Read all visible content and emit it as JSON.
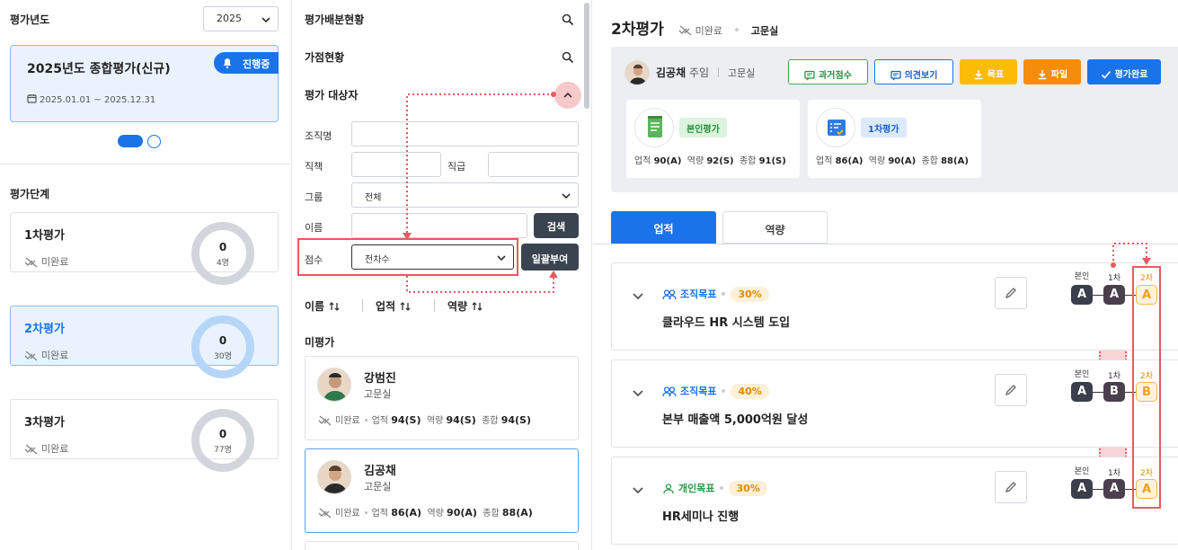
{
  "left": {
    "year_label": "평가년도",
    "year_value": "2025",
    "eval": {
      "title": "2025년도 종합평가(신규)",
      "badge": "진행중",
      "date_range": "2025.01.01 ~ 2025.12.31"
    },
    "stage_label": "평가단계",
    "stages": [
      {
        "name": "1차평가",
        "status": "미완료",
        "value": "0",
        "count": "4명"
      },
      {
        "name": "2차평가",
        "status": "미완료",
        "value": "0",
        "count": "30명"
      },
      {
        "name": "3차평가",
        "status": "미완료",
        "value": "0",
        "count": "77명"
      }
    ]
  },
  "middle": {
    "dist_title": "평가배분현황",
    "bonus_title": "가점현황",
    "target_title": "평가 대상자",
    "filters": {
      "org_label": "조직명",
      "duty_label": "직책",
      "grade_label": "직급",
      "group_label": "그룹",
      "group_value": "전체",
      "name_label": "이름",
      "search_btn": "검색",
      "score_label": "점수",
      "score_value": "전차수",
      "bulk_btn": "일괄부여"
    },
    "sort": {
      "name": "이름",
      "perf": "업적",
      "comp": "역량"
    },
    "list_title": "미평가",
    "people": [
      {
        "name": "강범진",
        "dept": "고문실",
        "status": "미완료",
        "perf_label": "업적",
        "perf": "94(S)",
        "comp_label": "역량",
        "comp": "94(S)",
        "total_label": "종합",
        "total": "94(S)"
      },
      {
        "name": "김공채",
        "dept": "고문실",
        "status": "미완료",
        "perf_label": "업적",
        "perf": "86(A)",
        "comp_label": "역량",
        "comp": "90(A)",
        "total_label": "종합",
        "total": "88(A)"
      }
    ]
  },
  "right": {
    "title": "2차평가",
    "status": "미완료",
    "dept": "고문실",
    "person": {
      "name": "김공채",
      "rank": "주임",
      "dept": "고문실"
    },
    "buttons": {
      "past": "과거점수",
      "opinion": "의견보기",
      "goal": "목표",
      "file": "파일",
      "complete": "평가완료"
    },
    "cards": [
      {
        "pill": "본인평가",
        "perf_label": "업적",
        "perf": "90(A)",
        "comp_label": "역량",
        "comp": "92(S)",
        "total_label": "종합",
        "total": "91(S)"
      },
      {
        "pill": "1차평가",
        "perf_label": "업적",
        "perf": "86(A)",
        "comp_label": "역량",
        "comp": "90(A)",
        "total_label": "종합",
        "total": "88(A)"
      }
    ],
    "tabs": [
      "업적",
      "역량"
    ],
    "grade_labels": {
      "self": "본인",
      "first": "1차",
      "second": "2차"
    },
    "goals": [
      {
        "type": "조직목표",
        "pct": "30%",
        "title": "클라우드 HR 시스템 도입",
        "self": "A",
        "first": "A",
        "second": "A"
      },
      {
        "type": "조직목표",
        "pct": "40%",
        "title": "본부 매출액 5,000억원 달성",
        "self": "A",
        "first": "B",
        "second": "B"
      },
      {
        "type": "개인목표",
        "pct": "30%",
        "title": "HR세미나 진행",
        "self": "A",
        "first": "A",
        "second": "A"
      }
    ]
  }
}
